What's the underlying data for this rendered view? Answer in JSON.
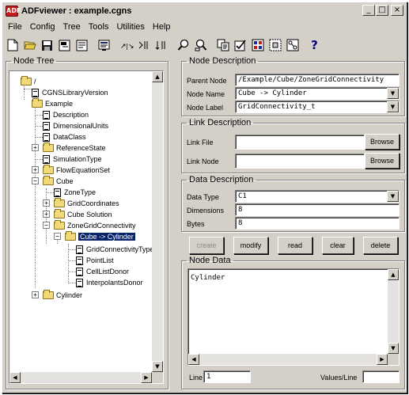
{
  "window": {
    "title": "ADFviewer : example.cgns",
    "controls": {
      "minimize": "_",
      "maximize": "□",
      "close": "×"
    }
  },
  "menu": [
    "File",
    "Config",
    "Tree",
    "Tools",
    "Utilities",
    "Help"
  ],
  "toolbar": {
    "icons": [
      "new-file-icon",
      "open-folder-icon",
      "save-icon",
      "save-as-icon",
      "properties-icon",
      "find-icon",
      "links-icon",
      "collapse-icon",
      "sort-icon",
      "zoom-in-icon",
      "zoom-out-icon",
      "copy-icon",
      "check-icon",
      "cut-icon",
      "paste-icon",
      "connect-icon",
      "help-icon"
    ],
    "help_label": "?"
  },
  "node_tree": {
    "legend": "Node Tree",
    "nodes": [
      {
        "label": "/",
        "type": "folder"
      },
      {
        "label": "CGNSLibraryVersion",
        "type": "doc"
      },
      {
        "label": "Example",
        "type": "folder"
      },
      {
        "label": "Description",
        "type": "doc"
      },
      {
        "label": "DimensionalUnits",
        "type": "doc"
      },
      {
        "label": "DataClass",
        "type": "doc"
      },
      {
        "label": "ReferenceState",
        "type": "folder"
      },
      {
        "label": "SimulationType",
        "type": "doc"
      },
      {
        "label": "FlowEquationSet",
        "type": "folder"
      },
      {
        "label": "Cube",
        "type": "folder"
      },
      {
        "label": "ZoneType",
        "type": "doc"
      },
      {
        "label": "GridCoordinates",
        "type": "folder"
      },
      {
        "label": "Cube Solution",
        "type": "folder"
      },
      {
        "label": "ZoneGridConnectivity",
        "type": "folder"
      },
      {
        "label": "Cube -> Cylinder",
        "type": "folder",
        "selected": true
      },
      {
        "label": "GridConnectivityType",
        "type": "doc"
      },
      {
        "label": "PointList",
        "type": "doc"
      },
      {
        "label": "CellListDonor",
        "type": "doc"
      },
      {
        "label": "InterpolantsDonor",
        "type": "doc"
      },
      {
        "label": "Cylinder",
        "type": "folder"
      }
    ]
  },
  "node_description": {
    "legend": "Node Description",
    "parent_node_label": "Parent Node",
    "parent_node_value": "/Example/Cube/ZoneGridConnectivity",
    "node_name_label": "Node Name",
    "node_name_value": "Cube -> Cylinder",
    "node_label_label": "Node Label",
    "node_label_value": "GridConnectivity_t"
  },
  "link_description": {
    "legend": "Link Description",
    "link_file_label": "Link File",
    "link_file_value": "",
    "link_node_label": "Link Node",
    "link_node_value": "",
    "browse_label": "Browse"
  },
  "data_description": {
    "legend": "Data Description",
    "data_type_label": "Data Type",
    "data_type_value": "C1",
    "dimensions_label": "Dimensions",
    "dimensions_value": "8",
    "bytes_label": "Bytes",
    "bytes_value": "8"
  },
  "actions": {
    "create": "create",
    "modify": "modify",
    "read": "read",
    "clear": "clear",
    "delete": "delete"
  },
  "node_data": {
    "legend": "Node Data",
    "content": "Cylinder",
    "line_label": "Line",
    "line_value": "1",
    "values_per_line_label": "Values/Line",
    "values_per_line_value": ""
  }
}
